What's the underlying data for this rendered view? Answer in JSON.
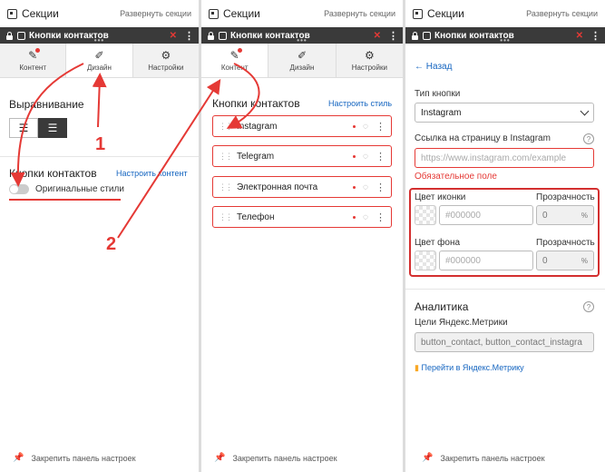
{
  "topbar": {
    "title": "Секции",
    "expand": "Развернуть секции"
  },
  "block": {
    "title": "Кнопки контактов"
  },
  "tabs": {
    "content": "Контент",
    "design": "Дизайн",
    "settings": "Настройки"
  },
  "panel1": {
    "align_title": "Выравнивание",
    "section_title": "Кнопки контактов",
    "configure_content": "Настроить контент",
    "original_styles": "Оригинальные стили"
  },
  "panel2": {
    "section_title": "Кнопки контактов",
    "configure_style": "Настроить стиль",
    "items": [
      {
        "label": "Instagram"
      },
      {
        "label": "Telegram"
      },
      {
        "label": "Электронная почта"
      },
      {
        "label": "Телефон"
      }
    ]
  },
  "panel3": {
    "back": "Назад",
    "button_type_label": "Тип кнопки",
    "button_type_value": "Instagram",
    "link_label": "Ссылка на страницу в Instagram",
    "link_placeholder": "https://www.instagram.com/example",
    "required": "Обязательное поле",
    "icon_color_label": "Цвет иконки",
    "opacity_label": "Прозрачность",
    "color_placeholder": "#000000",
    "opacity_value": "0",
    "opacity_unit": "%",
    "bg_color_label": "Цвет фона",
    "analytics_title": "Аналитика",
    "metrika_label": "Цели Яндекс.Метрики",
    "metrika_value": "button_contact, button_contact_instagra",
    "metrika_link": "Перейти в Яндекс.Метрику"
  },
  "footer": {
    "pin": "Закрепить панель настроек"
  },
  "annotations": {
    "one": "1",
    "two": "2"
  },
  "colors": {
    "accent_red": "#e53935",
    "link_blue": "#1565c0",
    "dark": "#3a3a3a"
  }
}
